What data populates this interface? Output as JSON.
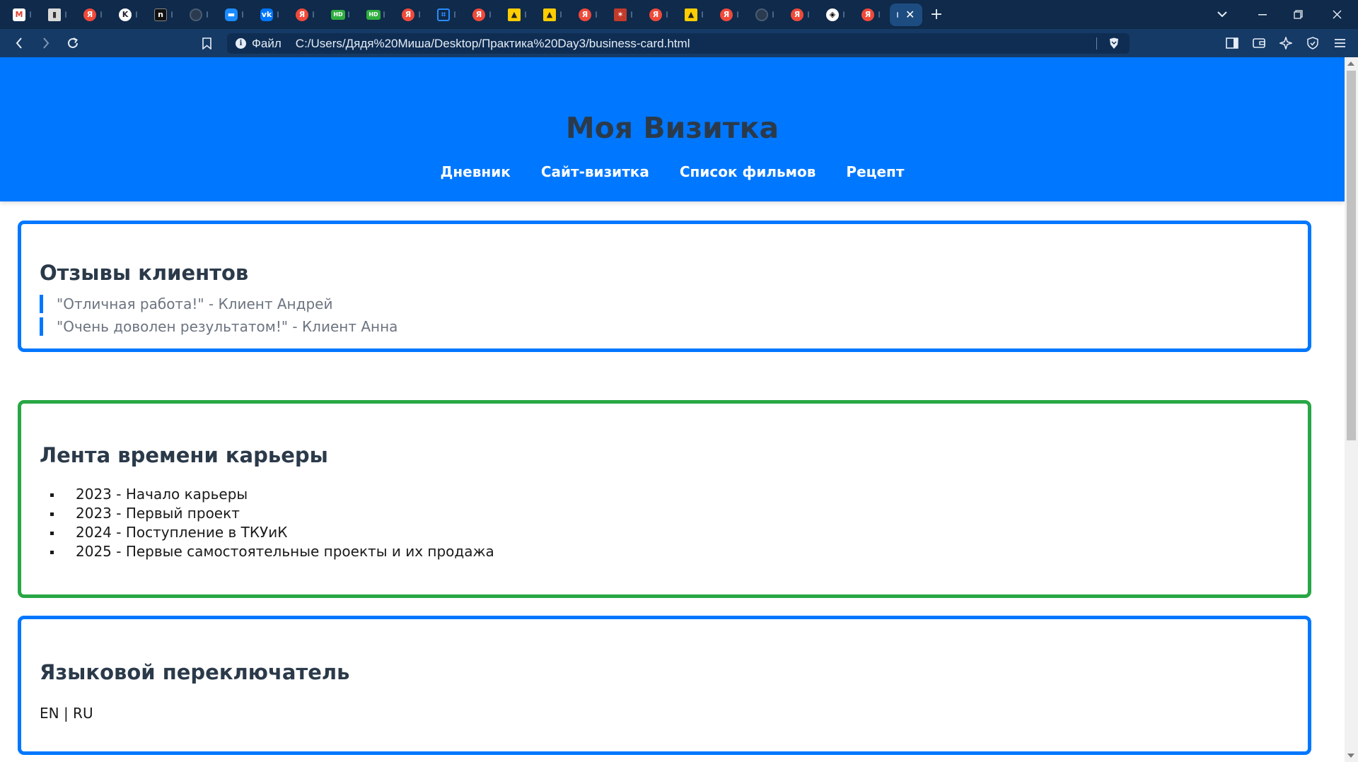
{
  "browser": {
    "tabs": [
      {
        "icon": "gmail-icon",
        "glyph": "M",
        "cls": "fav-gmail"
      },
      {
        "icon": "book-icon",
        "glyph": "▮",
        "cls": "fav-book"
      },
      {
        "icon": "yandex-icon",
        "glyph": "Я",
        "cls": "fav-ya"
      },
      {
        "icon": "wiki-icon",
        "glyph": "K",
        "cls": "fav-wiki"
      },
      {
        "icon": "notion-icon",
        "glyph": "n",
        "cls": "fav-dark"
      },
      {
        "icon": "github-icon",
        "glyph": "",
        "cls": "fav-gh"
      },
      {
        "icon": "chat-icon",
        "glyph": "▬",
        "cls": "fav-chat"
      },
      {
        "icon": "vk-icon",
        "glyph": "vk",
        "cls": "fav-vk"
      },
      {
        "icon": "yandex-icon",
        "glyph": "Я",
        "cls": "fav-ya"
      },
      {
        "icon": "hd-icon",
        "glyph": "HD",
        "cls": "fav-hd"
      },
      {
        "icon": "hd-icon",
        "glyph": "HD",
        "cls": "fav-hd"
      },
      {
        "icon": "yandex-icon",
        "glyph": "Я",
        "cls": "fav-ya"
      },
      {
        "icon": "grid-icon",
        "glyph": "⌗",
        "cls": "fav-grid"
      },
      {
        "icon": "yandex-icon",
        "glyph": "Я",
        "cls": "fav-ya"
      },
      {
        "icon": "maps-icon",
        "glyph": "▲",
        "cls": "fav-map"
      },
      {
        "icon": "maps-icon",
        "glyph": "▲",
        "cls": "fav-map"
      },
      {
        "icon": "yandex-icon",
        "glyph": "Я",
        "cls": "fav-ya"
      },
      {
        "icon": "red-app-icon",
        "glyph": "✶",
        "cls": "fav-red"
      },
      {
        "icon": "yandex-icon",
        "glyph": "Я",
        "cls": "fav-ya"
      },
      {
        "icon": "maps-icon",
        "glyph": "▲",
        "cls": "fav-map"
      },
      {
        "icon": "yandex-icon",
        "glyph": "Я",
        "cls": "fav-ya"
      },
      {
        "icon": "github-icon",
        "glyph": "",
        "cls": "fav-gh"
      },
      {
        "icon": "yandex-icon",
        "glyph": "Я",
        "cls": "fav-ya"
      },
      {
        "icon": "codepen-icon",
        "glyph": "◈",
        "cls": "fav-cp"
      },
      {
        "icon": "yandex-icon",
        "glyph": "Я",
        "cls": "fav-ya"
      }
    ],
    "address": {
      "scheme_label": "Файл",
      "url": "C:/Users/Дядя%20Миша/Desktop/Практика%20Day3/business-card.html"
    }
  },
  "page": {
    "site_title": "Моя Визитка",
    "nav": [
      "Дневник",
      "Сайт-визитка",
      "Список фильмов",
      "Рецепт"
    ],
    "reviews": {
      "heading": "Отзывы клиентов",
      "items": [
        "\"Отличная работа!\" - Клиент Андрей",
        "\"Очень доволен результатом!\" - Клиент Анна"
      ]
    },
    "timeline": {
      "heading": "Лента времени карьеры",
      "items": [
        "2023 - Начало карьеры",
        "2023 - Первый проект",
        "2024 - Поступление в ТКУиК",
        "2025 - Первые самостоятельные проекты и их продажа"
      ]
    },
    "language": {
      "heading": "Языковой переключатель",
      "text": "EN | RU"
    }
  },
  "colors": {
    "header": "#0077ff",
    "accent_blue": "#0077ff",
    "accent_green": "#28a745",
    "browser_tabstrip": "#0f2a4a",
    "browser_toolbar": "#163a66"
  }
}
